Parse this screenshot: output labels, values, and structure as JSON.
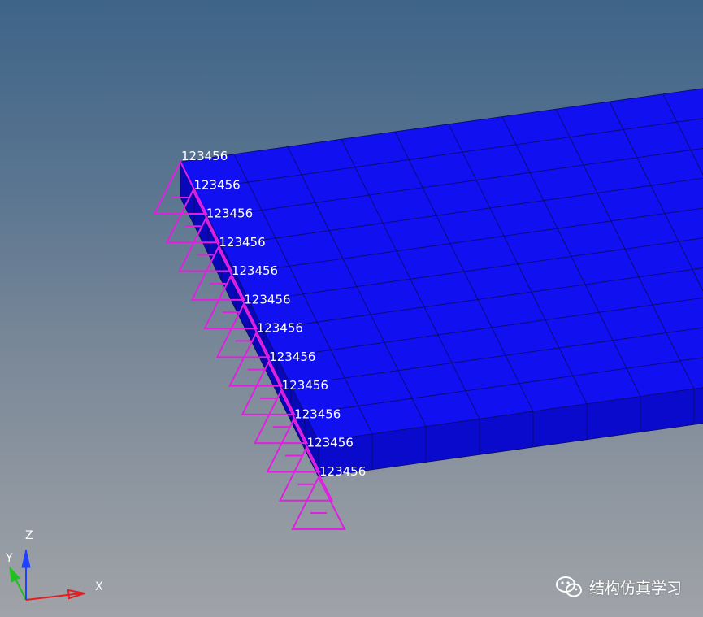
{
  "model": {
    "mesh_color": "#1010f0",
    "side_color": "#0a0acc",
    "edge_color": "#0a0a60",
    "constraint_color": "#e020e0",
    "constraint_label": "123456",
    "constraint_count": 12
  },
  "triad": {
    "x_label": "X",
    "y_label": "Y",
    "z_label": "Z",
    "x_color": "#e02020",
    "y_color": "#20c020",
    "z_color": "#2040ff"
  },
  "watermark": {
    "text": "结构仿真学习",
    "icon": "wechat-icon"
  }
}
